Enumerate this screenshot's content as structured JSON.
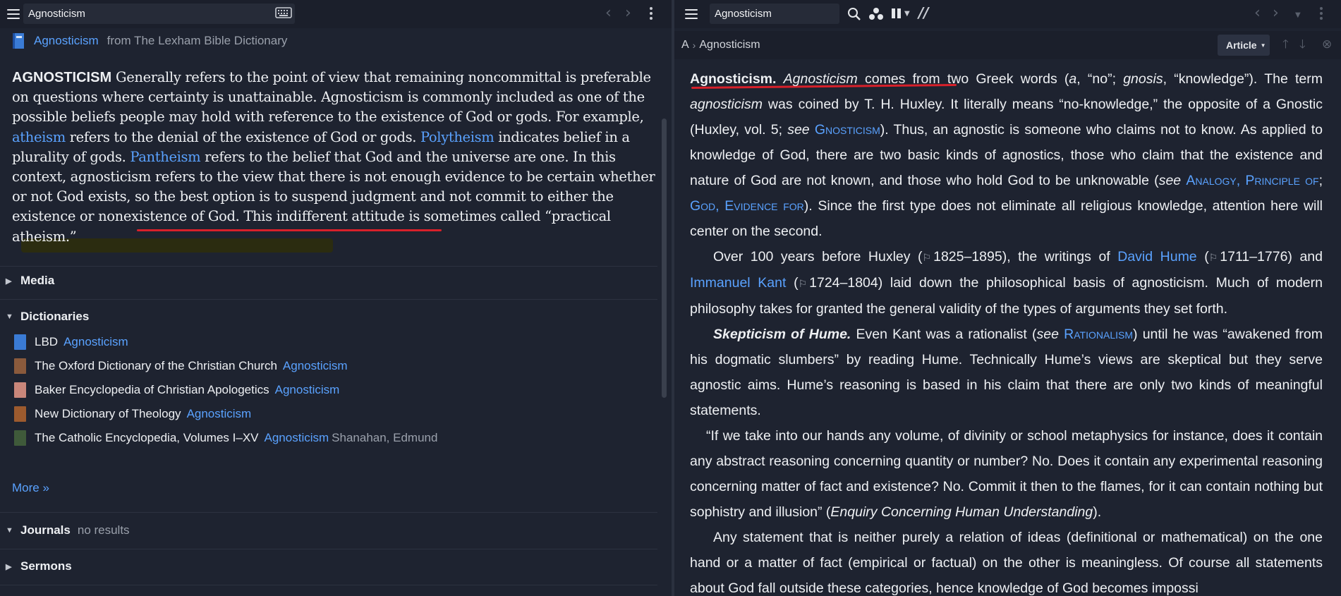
{
  "left_pane": {
    "search_value": "Agnosticism",
    "resource": {
      "title": "Agnosticism",
      "source": "from The Lexham Bible Dictionary"
    },
    "article": {
      "headword": "AGNOSTICISM",
      "seg1": " Generally refers to the point of view that remaining noncommittal is preferable on questions where certainty is unattainable. Agnosticism is commonly included as one of the possible beliefs people may hold with reference to the existence of God or gods. For example, ",
      "link_atheism": "atheism",
      "seg2": " refers to the denial of the existence of God or gods. ",
      "link_polytheism": "Polytheism",
      "seg3": " indicates belief in a plurality of gods. ",
      "link_pantheism": "Pantheism",
      "seg4": " refers to the belief that God and the universe are one. In this context, agnosticism refers to the view that there is not enough evidence to be certain whether or not God exists, so the best option is to suspend judgment and not commit to either the existence or nonexistence of God. This indifferent attitude is sometimes called “practical atheism.”"
    },
    "sections": {
      "media": "Media",
      "dictionaries": "Dictionaries",
      "journals": "Journals",
      "journals_status": "no results",
      "sermons": "Sermons"
    },
    "dictionaries": [
      {
        "title": "LBD",
        "entry": "Agnosticism",
        "author": "",
        "color": "#3a7bd5"
      },
      {
        "title": "The Oxford Dictionary of the Christian Church",
        "entry": "Agnosticism",
        "author": "",
        "color": "#8a5a3c"
      },
      {
        "title": "Baker Encyclopedia of Christian Apologetics",
        "entry": "Agnosticism",
        "author": "",
        "color": "#c9867a"
      },
      {
        "title": "New Dictionary of Theology",
        "entry": "Agnosticism",
        "author": "",
        "color": "#9c5a2e"
      },
      {
        "title": "The Catholic Encyclopedia, Volumes I–XV",
        "entry": "Agnosticism",
        "author": "Shanahan, Edmund",
        "color": "#3f5a3a"
      }
    ],
    "more_label": "More »"
  },
  "right_pane": {
    "search_value": "Agnosticism",
    "breadcrumb": [
      "A",
      "Agnosticism"
    ],
    "article_button": "Article",
    "article": {
      "p1_headword": "Agnosticism.",
      "p1_a": " ",
      "p1_i1": "Agnosticism",
      "p1_b": " comes from two Greek words (",
      "p1_i2": "a",
      "p1_c": ", “no”; ",
      "p1_i3": "gnosis",
      "p1_d": ", “knowledge”). The term ",
      "p1_i4": "agnosticism",
      "p1_e": " was coined by T. H. Huxley. It literally means “no-knowledge,” the opposite of a Gnos­tic (Huxley, vol. 5; ",
      "p1_see1": "see",
      "p1_link1": "Gnosticism",
      "p1_f": "). Thus, an agnostic is someone who claims not to know. As applied to knowledge of God, there are two basic kinds of agnostics, those who claim that the existence and nature of God are not known, and those who hold God to be unknowable (",
      "p1_see2": "see",
      "p1_link2": "Anal­ogy, Principle of",
      "p1_g": "; ",
      "p1_link3": "God, Evidence for",
      "p1_h": "). Since the first type does not eliminate all religious knowledge, attention here will center on the second.",
      "p2_a": "Over 100 years before Huxley (",
      "p2_d1": "1825–1895",
      "p2_b": "), the writings of ",
      "p2_link1": "David Hume",
      "p2_c": " (",
      "p2_d2": "1711–1776",
      "p2_e": ") and ",
      "p2_link2": "Immanuel Kant",
      "p2_f": " (",
      "p2_d3": "1724–1804",
      "p2_g": ") laid down the philosophical basis of agnosticism. Much of modern philosophy takes for granted the general validity of the types of arguments they set forth.",
      "p3_head": "Skepticism of Hume.",
      "p3_a": " Even Kant was a rationalist (",
      "p3_see": "see",
      "p3_link": "Rationalism",
      "p3_b": ") until he was “awakened from his dogmatic slumbers” by reading Hume. Technically Hume’s views are skeptical but they serve agnostic aims. Hume’s reasoning is based in his claim that there are only two kinds of mean­ingful statements.",
      "p4_a": "“If we take into our hands any volume, of divinity or school metaphysics for instance, does it contain any abstract reasoning concerning quantity or number? No. Does it contain any experi­mental reasoning concerning matter of fact and existence? No. Commit it then to the flames, for it can contain nothing but sophistry and illusion” (",
      "p4_i": "Enquiry Concerning Human Understanding",
      "p4_b": ").",
      "p5": "Any statement that is neither purely a relation of ideas (definitional or mathematical) on the one hand or a matter of fact (empirical or factual) on the other is meaningless. Of course all statements about God fall outside these categories, hence knowledge of God becomes impossi­"
    }
  },
  "colors": {
    "background": "#1e2330",
    "toolbar": "#1b1f2b",
    "link": "#5aa2ff",
    "annotation_underline": "#d8202a",
    "highlight": "#2b2c10"
  }
}
